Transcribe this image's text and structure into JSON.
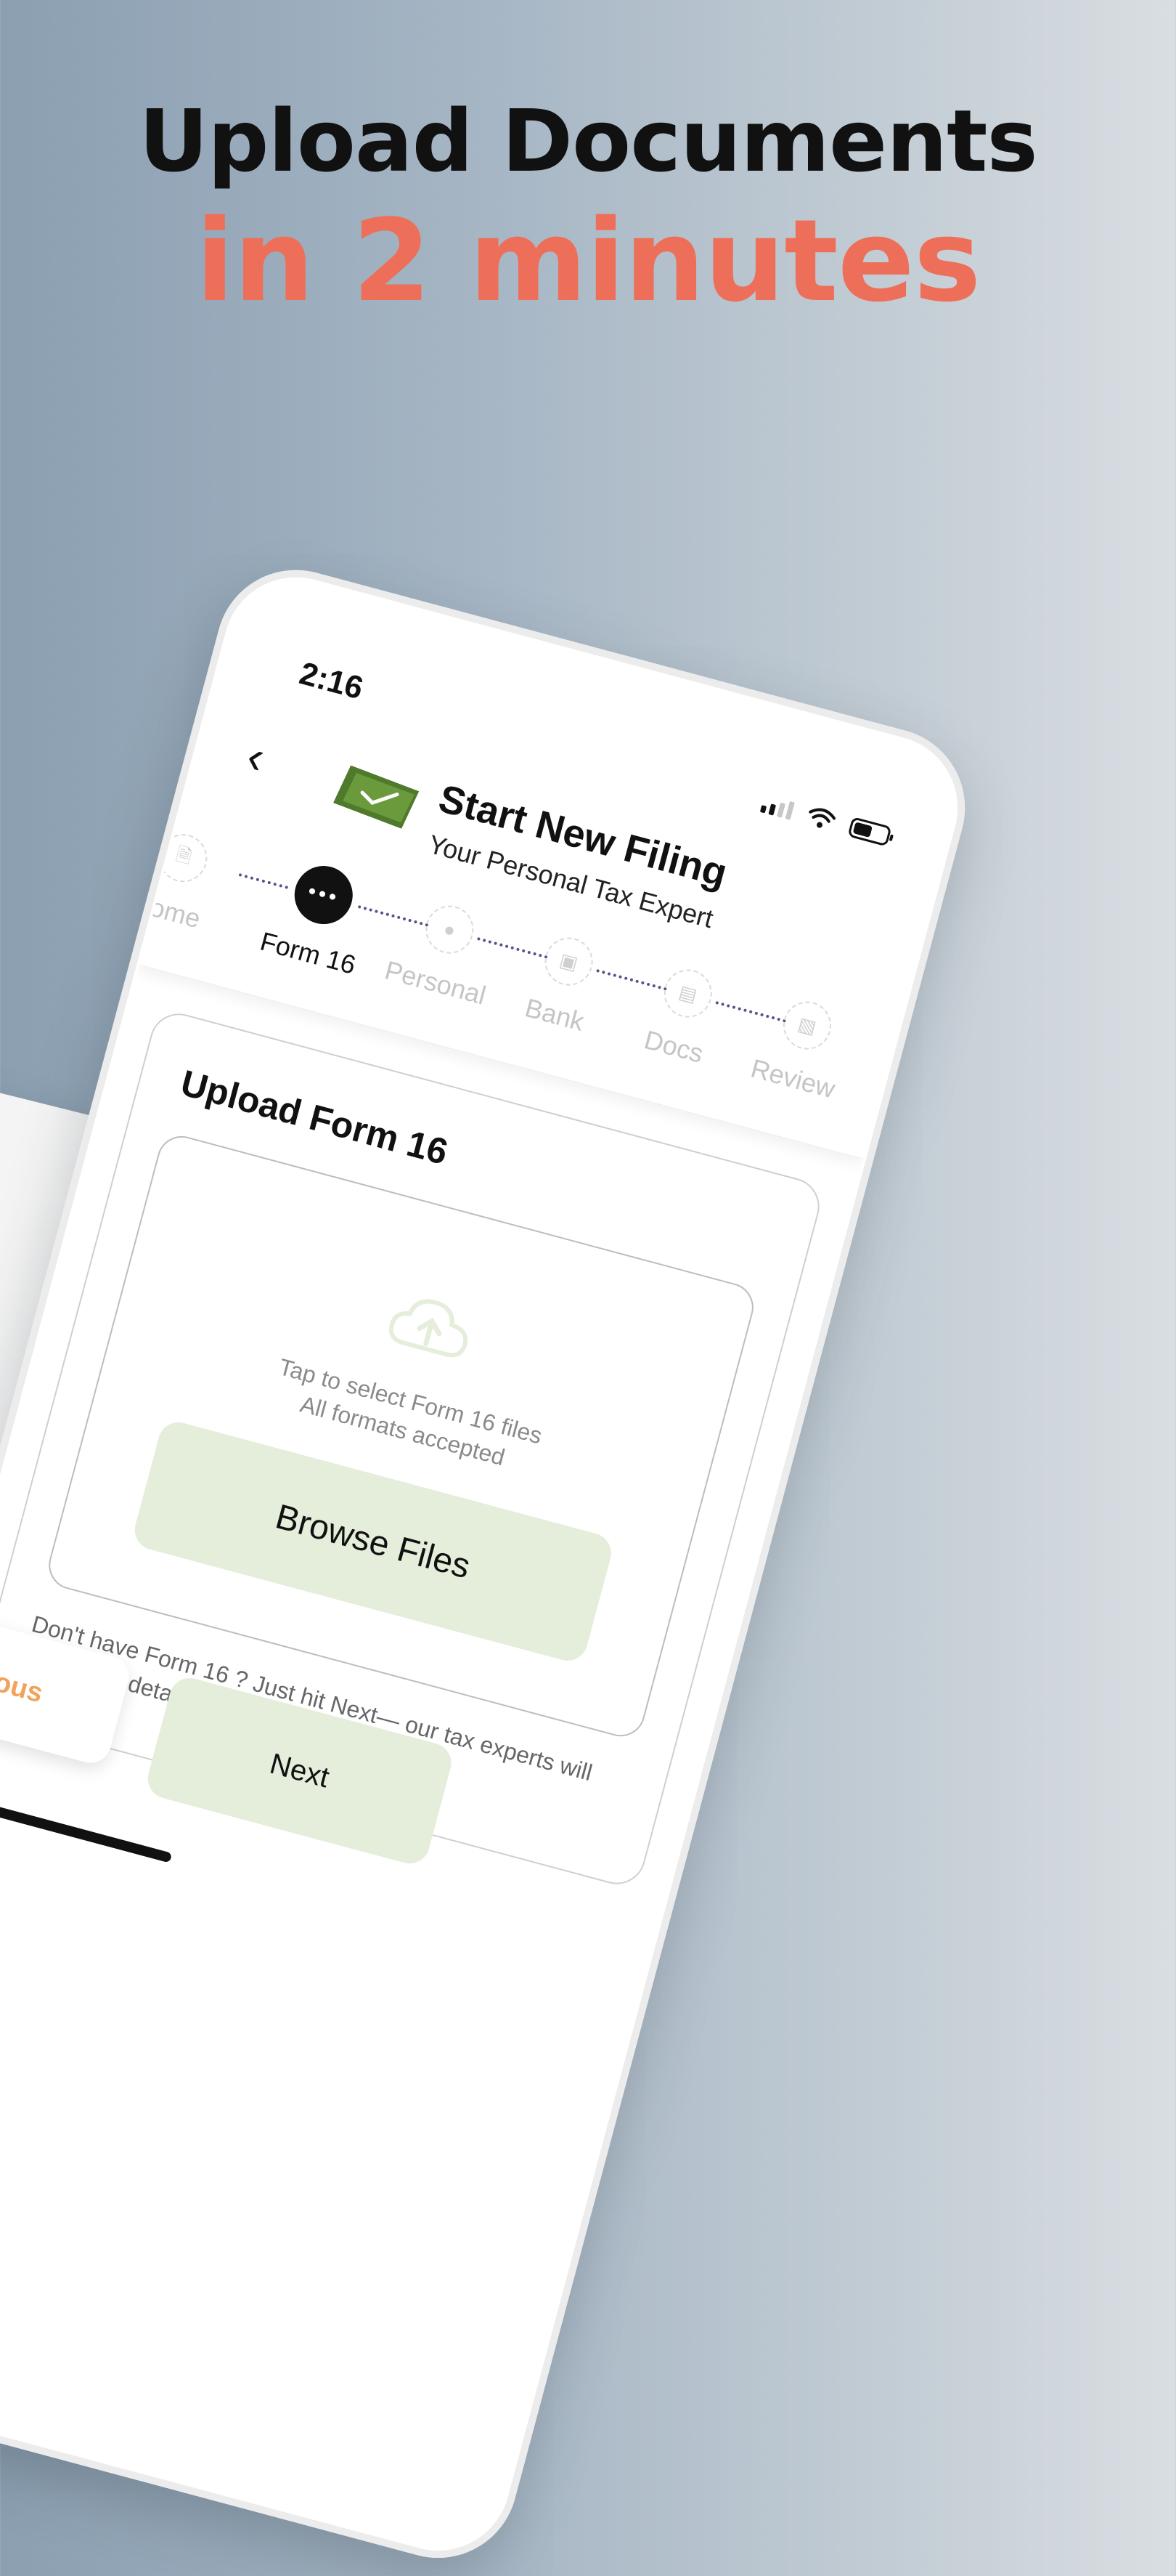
{
  "promo": {
    "line1": "Upload Documents",
    "line2": "in 2 minutes"
  },
  "status_bar": {
    "time": "2:16"
  },
  "header": {
    "back_icon": "chevron-left-icon",
    "title": "Start New Filing",
    "subtitle": "Your Personal Tax Expert"
  },
  "stepper": {
    "steps": [
      {
        "label": "come",
        "icon": "document-icon",
        "state": "done"
      },
      {
        "label": "Form 16",
        "icon": "more-dots-icon",
        "state": "active"
      },
      {
        "label": "Personal",
        "icon": "person-icon",
        "state": "pending"
      },
      {
        "label": "Bank",
        "icon": "wallet-icon",
        "state": "pending"
      },
      {
        "label": "Docs",
        "icon": "file-icon",
        "state": "pending"
      },
      {
        "label": "Review",
        "icon": "review-icon",
        "state": "pending"
      }
    ]
  },
  "upload": {
    "title": "Upload Form 16",
    "hint_line1": "Tap to select Form 16 files",
    "hint_line2": "All formats accepted",
    "browse_label": "Browse Files",
    "note": "Don't have Form 16 ? Just hit Next— our tax experts will fetch your details from the ITR portal."
  },
  "footer": {
    "previous_label": "Previous",
    "next_label": "Next"
  },
  "colors": {
    "accent": "#ee6f59",
    "button_bg": "#e4eedb",
    "previous_text": "#f2a25a",
    "connector": "#5a4f89"
  }
}
